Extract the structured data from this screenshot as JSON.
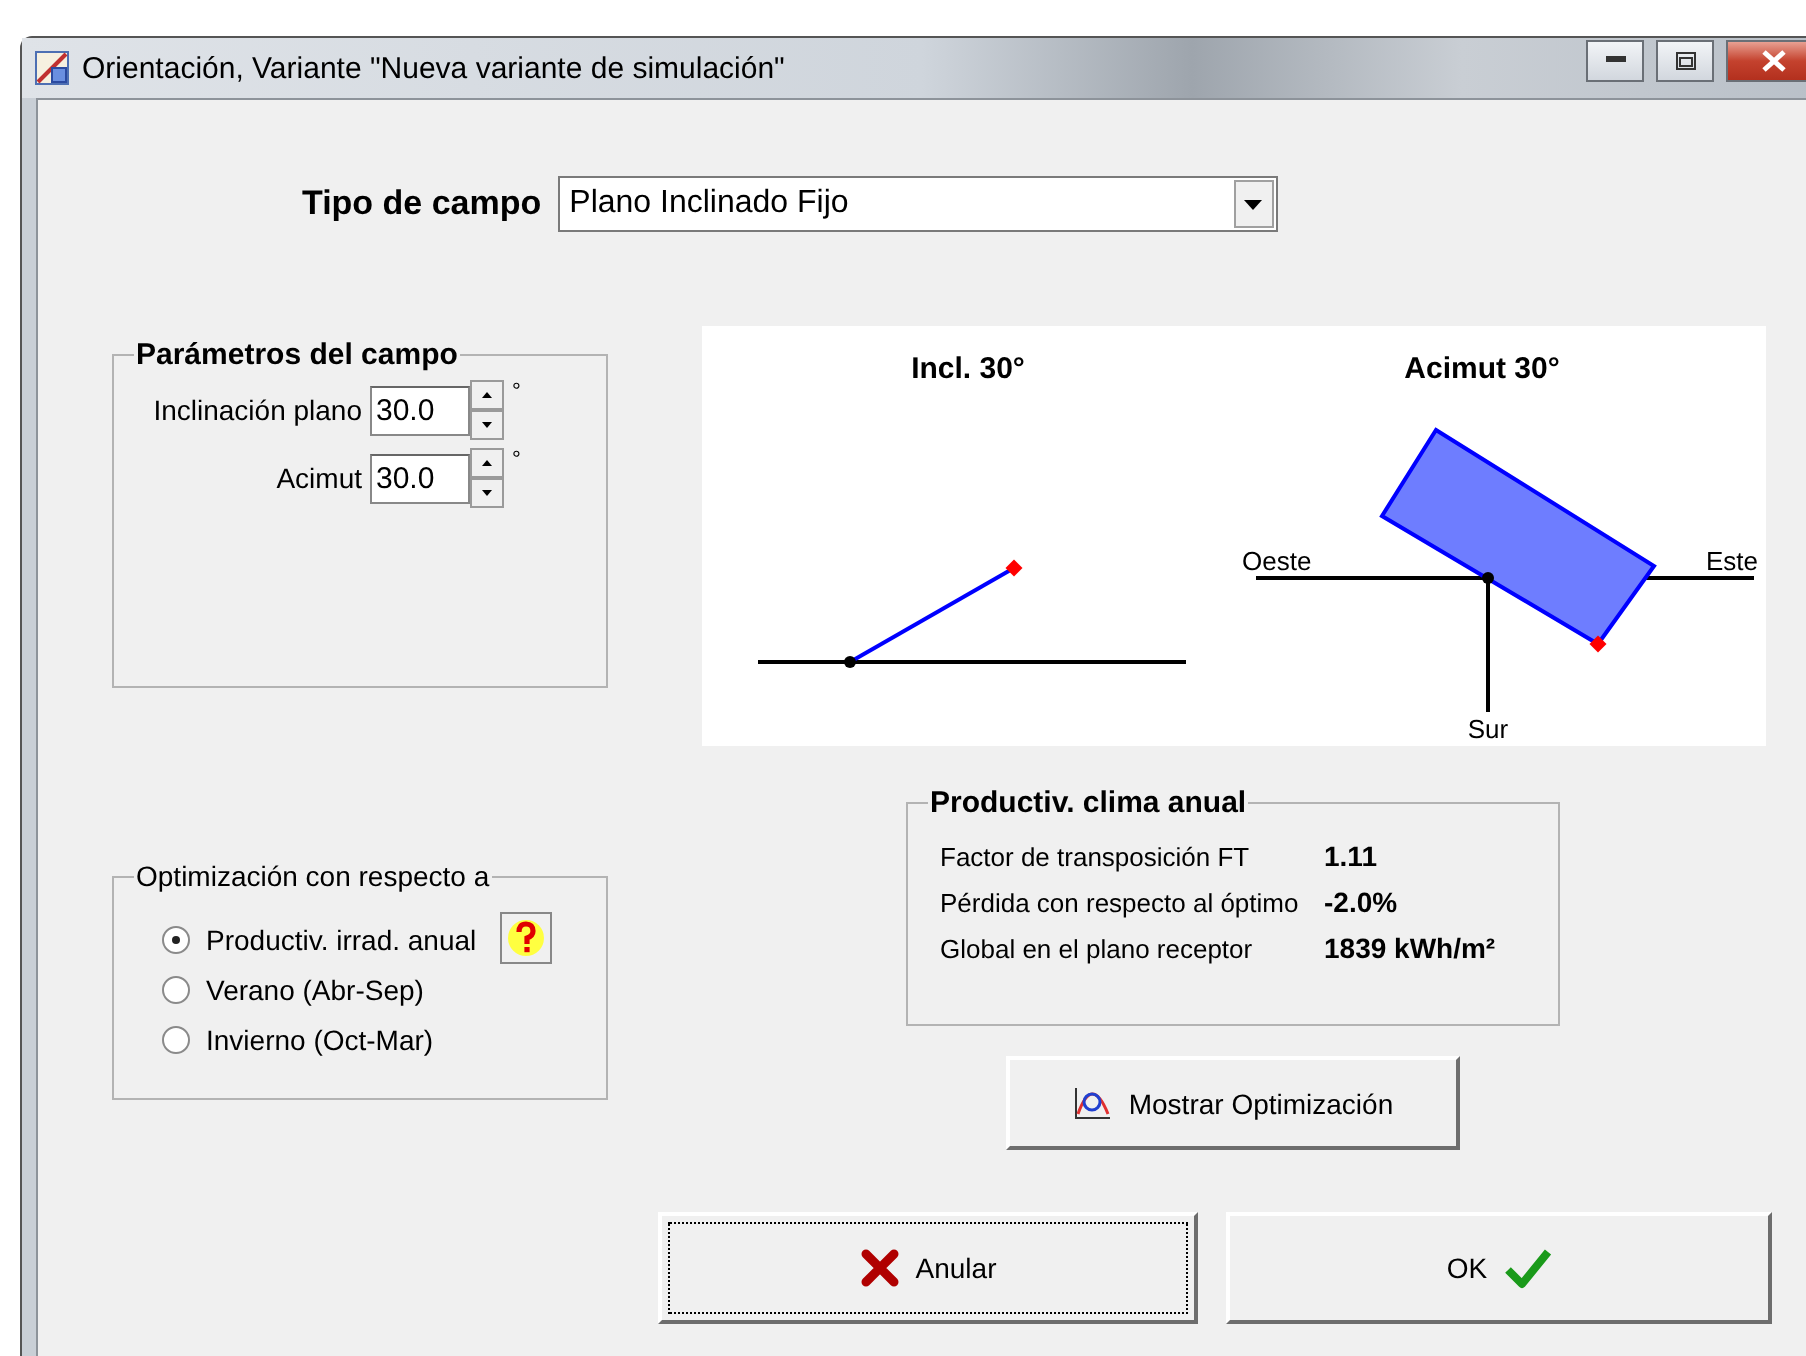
{
  "window": {
    "title": "Orientación, Variante \"Nueva variante de simulación\""
  },
  "field_type": {
    "label": "Tipo de campo",
    "value": "Plano Inclinado Fijo"
  },
  "parameters": {
    "title": "Parámetros del campo",
    "fields": [
      {
        "label": "Inclinación plano",
        "value": "30.0",
        "unit": "°"
      },
      {
        "label": "Acimut",
        "value": "30.0",
        "unit": "°"
      }
    ]
  },
  "diagram": {
    "tilt_title": "Incl. 30°",
    "azimuth_title": "Acimut 30°",
    "west": "Oeste",
    "east": "Este",
    "south": "Sur"
  },
  "optimization": {
    "title": "Optimización con respecto a",
    "options": [
      {
        "label": "Productiv. irrad. anual",
        "selected": true
      },
      {
        "label": "Verano (Abr-Sep)",
        "selected": false
      },
      {
        "label": "Invierno (Oct-Mar)",
        "selected": false
      }
    ]
  },
  "results": {
    "title": "Productiv. clima anual",
    "rows": [
      {
        "label": "Factor de transposición FT",
        "value": "1.11"
      },
      {
        "label": "Pérdida con respecto al óptimo",
        "value": "-2.0%"
      },
      {
        "label": "Global en el plano receptor",
        "value": "1839 kWh/m²"
      }
    ]
  },
  "show_button": "Mostrar Optimización",
  "buttons": [
    {
      "label": "Anular",
      "kind": "cancel"
    },
    {
      "label": "OK",
      "kind": "ok"
    }
  ]
}
